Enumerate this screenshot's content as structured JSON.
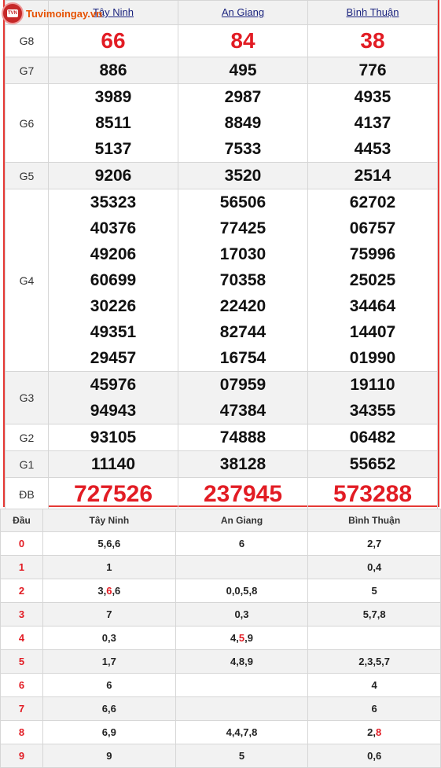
{
  "logo": {
    "text": "Tuvimoingay.vn",
    "badge": "TVN"
  },
  "results": {
    "provinces": [
      "Tây Ninh",
      "An Giang",
      "Bình Thuận"
    ],
    "rows": [
      {
        "label": "G8",
        "style": "big",
        "values": [
          [
            "66"
          ],
          [
            "84"
          ],
          [
            "38"
          ]
        ]
      },
      {
        "label": "G7",
        "style": "normal",
        "values": [
          [
            "886"
          ],
          [
            "495"
          ],
          [
            "776"
          ]
        ]
      },
      {
        "label": "G6",
        "style": "normal",
        "values": [
          [
            "3989",
            "8511",
            "5137"
          ],
          [
            "2987",
            "8849",
            "7533"
          ],
          [
            "4935",
            "4137",
            "4453"
          ]
        ]
      },
      {
        "label": "G5",
        "style": "normal",
        "values": [
          [
            "9206"
          ],
          [
            "3520"
          ],
          [
            "2514"
          ]
        ]
      },
      {
        "label": "G4",
        "style": "normal",
        "values": [
          [
            "35323",
            "40376",
            "49206",
            "60699",
            "30226",
            "49351",
            "29457"
          ],
          [
            "56506",
            "77425",
            "17030",
            "70358",
            "22420",
            "82744",
            "16754"
          ],
          [
            "62702",
            "06757",
            "75996",
            "25025",
            "34464",
            "14407",
            "01990"
          ]
        ]
      },
      {
        "label": "G3",
        "style": "normal",
        "values": [
          [
            "45976",
            "94943"
          ],
          [
            "07959",
            "47384"
          ],
          [
            "19110",
            "34355"
          ]
        ]
      },
      {
        "label": "G2",
        "style": "normal",
        "values": [
          [
            "93105"
          ],
          [
            "74888"
          ],
          [
            "06482"
          ]
        ]
      },
      {
        "label": "G1",
        "style": "normal",
        "values": [
          [
            "11140"
          ],
          [
            "38128"
          ],
          [
            "55652"
          ]
        ]
      },
      {
        "label": "ĐB",
        "style": "spec",
        "values": [
          [
            "727526"
          ],
          [
            "237945"
          ],
          [
            "573288"
          ]
        ]
      }
    ]
  },
  "loto": {
    "headers": [
      "Đầu",
      "Tây Ninh",
      "An Giang",
      "Bình Thuận"
    ],
    "rows": [
      {
        "dau": "0",
        "cells": [
          [
            [
              "5,6,6",
              false
            ]
          ],
          [
            [
              "6",
              false
            ]
          ],
          [
            [
              "2,7",
              false
            ]
          ]
        ]
      },
      {
        "dau": "1",
        "cells": [
          [
            [
              "1",
              false
            ]
          ],
          [],
          [
            [
              "0,4",
              false
            ]
          ]
        ]
      },
      {
        "dau": "2",
        "cells": [
          [
            [
              "3,",
              false
            ],
            [
              "6",
              true
            ],
            [
              ",6",
              false
            ]
          ],
          [
            [
              "0,0,5,8",
              false
            ]
          ],
          [
            [
              "5",
              false
            ]
          ]
        ]
      },
      {
        "dau": "3",
        "cells": [
          [
            [
              "7",
              false
            ]
          ],
          [
            [
              "0,3",
              false
            ]
          ],
          [
            [
              "5,7,8",
              false
            ]
          ]
        ]
      },
      {
        "dau": "4",
        "cells": [
          [
            [
              "0,3",
              false
            ]
          ],
          [
            [
              "4,",
              false
            ],
            [
              "5",
              true
            ],
            [
              ",9",
              false
            ]
          ],
          []
        ]
      },
      {
        "dau": "5",
        "cells": [
          [
            [
              "1,7",
              false
            ]
          ],
          [
            [
              "4,8,9",
              false
            ]
          ],
          [
            [
              "2,3,5,7",
              false
            ]
          ]
        ]
      },
      {
        "dau": "6",
        "cells": [
          [
            [
              "6",
              false
            ]
          ],
          [],
          [
            [
              "4",
              false
            ]
          ]
        ]
      },
      {
        "dau": "7",
        "cells": [
          [
            [
              "6,6",
              false
            ]
          ],
          [],
          [
            [
              "6",
              false
            ]
          ]
        ]
      },
      {
        "dau": "8",
        "cells": [
          [
            [
              "6,9",
              false
            ]
          ],
          [
            [
              "4,4,7,8",
              false
            ]
          ],
          [
            [
              "2,",
              false
            ],
            [
              "8",
              true
            ]
          ]
        ]
      },
      {
        "dau": "9",
        "cells": [
          [
            [
              "9",
              false
            ]
          ],
          [
            [
              "5",
              false
            ]
          ],
          [
            [
              "0,6",
              false
            ]
          ]
        ]
      }
    ]
  },
  "colors": {
    "accent_red": "#e21c24",
    "link_blue": "#1a237e",
    "border_red": "#e53935",
    "stripe": "#f2f2f2"
  }
}
